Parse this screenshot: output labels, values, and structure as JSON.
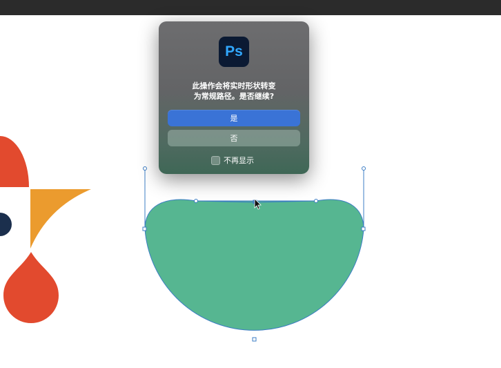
{
  "dialog": {
    "app_icon": "photoshop-icon",
    "app_icon_text": "Ps",
    "message_line1": "此操作会将实时形状转变",
    "message_line2": "为常规路径。是否继续?",
    "yes_label": "是",
    "no_label": "否",
    "suppress_label": "不再显示",
    "suppress_checked": false
  },
  "colors": {
    "circle_fill": "#56b691",
    "path_stroke": "#3b7cc4",
    "shape_red": "#e24a2e",
    "shape_orange": "#eb9b2e",
    "shape_navy": "#1b2f4d",
    "yes_button": "#3a73d6"
  }
}
